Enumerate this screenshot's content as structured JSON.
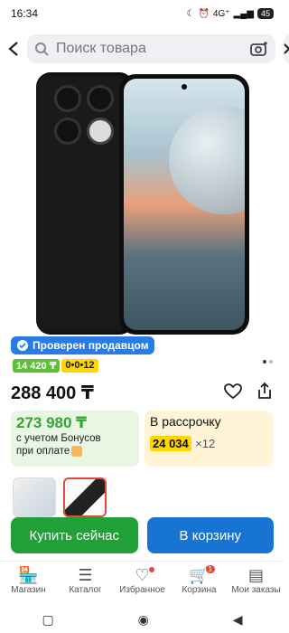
{
  "status": {
    "time": "16:34",
    "network": "4G⁺",
    "battery": "45"
  },
  "search": {
    "placeholder": "Поиск товара"
  },
  "seller": {
    "verified_label": "Проверен продавцом"
  },
  "badges": {
    "bonus": "14 420 ₸",
    "installment": "0•0•12"
  },
  "product": {
    "price": "288 400 ₸"
  },
  "bonus_card": {
    "price": "273 980 ₸",
    "line1": "с учетом Бонусов",
    "line2": "при оплате"
  },
  "installment_card": {
    "title": "В рассрочку",
    "monthly": "24 034",
    "months": "×12"
  },
  "actions": {
    "buy_now": "Купить сейчас",
    "add_to_cart": "В корзину"
  },
  "nav": {
    "items": [
      {
        "label": "Магазин",
        "icon": "store-icon"
      },
      {
        "label": "Каталог",
        "icon": "catalog-icon"
      },
      {
        "label": "Избранное",
        "icon": "heart-icon"
      },
      {
        "label": "Корзина",
        "icon": "cart-icon",
        "badge": "1"
      },
      {
        "label": "Мои заказы",
        "icon": "orders-icon"
      }
    ]
  },
  "colors": {
    "green": "#21a038",
    "blue": "#1874d2",
    "verified": "#2a7be4",
    "yellow": "#ffd600"
  }
}
